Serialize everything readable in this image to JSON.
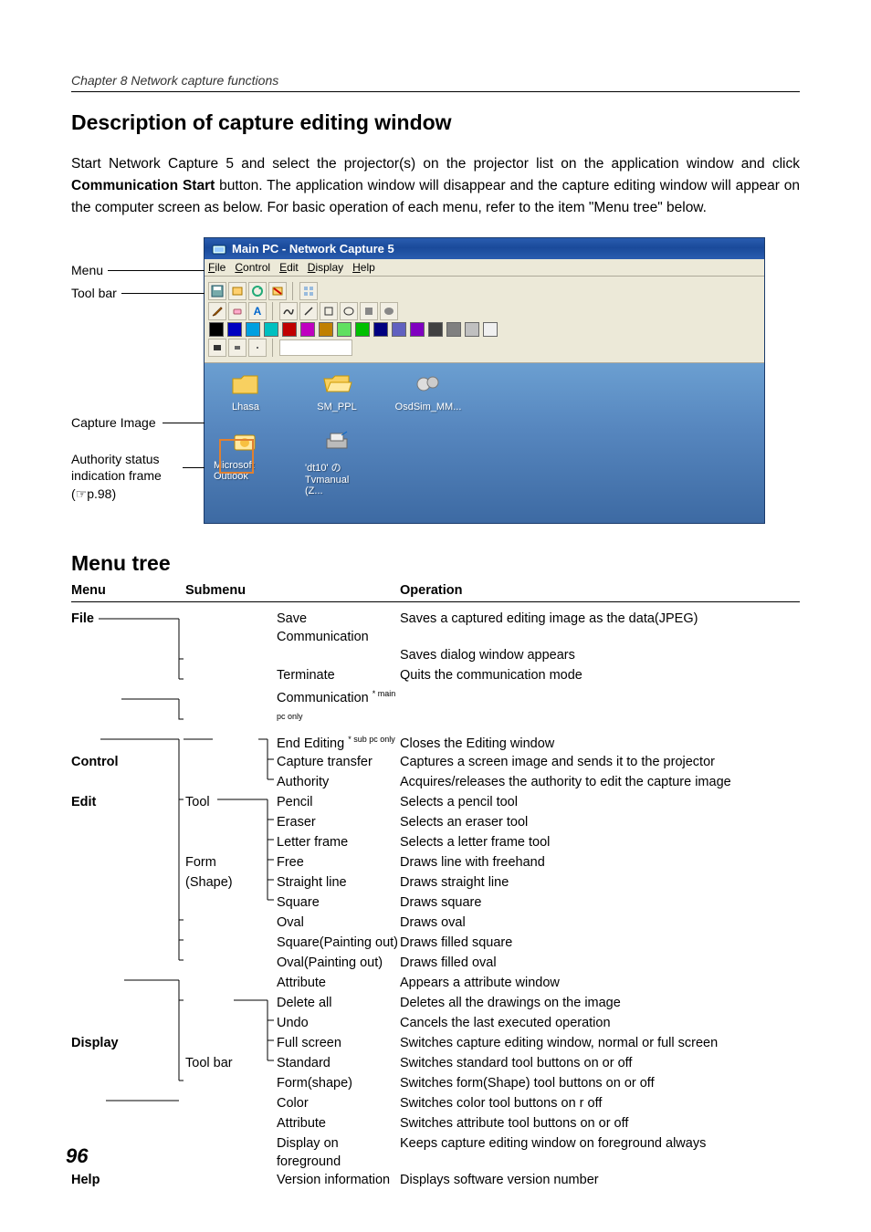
{
  "header": {
    "chapter": "Chapter 8 Network capture functions"
  },
  "section1": {
    "title": "Description of capture editing window",
    "intro_pre": "Start Network Capture 5 and select the projector(s) on the projector list on the application window and click ",
    "intro_bold": "Communication Start",
    "intro_post": " button. The application window will disappear and the capture editing window will appear on the computer screen as below. For basic operation of each menu, refer to the item \"Menu tree\" below."
  },
  "figure": {
    "labels": {
      "menu": "Menu",
      "toolbar": "Tool bar",
      "capture": "Capture Image",
      "auth1": "Authority status",
      "auth2": "indication frame",
      "auth3": "(☞p.98)"
    },
    "window": {
      "title": "Main PC - Network Capture 5",
      "menus": {
        "file": "File",
        "control": "Control",
        "edit": "Edit",
        "display": "Display",
        "help": "Help"
      },
      "swatches": [
        "#000000",
        "#0000c0",
        "#00a0e0",
        "#00c0c0",
        "#c00000",
        "#c000c0",
        "#c08000",
        "#60e060",
        "#00c000",
        "#000080",
        "#6060c0",
        "#8000c0",
        "#404040",
        "#808080",
        "#c0c0c0",
        "#f0f0f0"
      ],
      "desktop": {
        "row1": [
          {
            "name": "Lhasa",
            "icon": "folder"
          },
          {
            "name": "SM_PPL",
            "icon": "folder-open"
          },
          {
            "name": "OsdSim_MM...",
            "icon": "gears"
          }
        ],
        "row2": [
          {
            "name": "Microsoft Outlook",
            "icon": "outlook"
          },
          {
            "name": "'dt10' の Tvmanual (Z...",
            "icon": "printer"
          }
        ]
      }
    }
  },
  "section2": {
    "title": "Menu tree",
    "headers": {
      "menu": "Menu",
      "submenu": "Submenu",
      "operation": "Operation"
    },
    "rows": [
      {
        "c1": "File",
        "c2a": "",
        "c2b": "Save Communication",
        "c3": "Saves a captured editing image as the data(JPEG)"
      },
      {
        "c1": "",
        "c2a": "",
        "c2b": "",
        "c3": "Saves dialog window appears"
      },
      {
        "c1": "",
        "c2a": "",
        "c2b_pre": "Terminate Communication ",
        "c2b_sup": "* main pc only",
        "c3": "Quits the communication mode"
      },
      {
        "c1": "",
        "c2a": "",
        "c2b_pre": "End Editing ",
        "c2b_sup": "* sub pc only",
        "c3": "Closes the Editing window"
      },
      {
        "c1": "Control",
        "c2a": "",
        "c2b": "Capture transfer",
        "c3": "Captures a screen image and sends it to the projector"
      },
      {
        "c1": "",
        "c2a": "",
        "c2b": "Authority",
        "c3": "Acquires/releases the authority to edit the capture image"
      },
      {
        "c1": "Edit",
        "c2a": "Tool",
        "c2b": "Pencil",
        "c3": "Selects a pencil tool"
      },
      {
        "c1": "",
        "c2a": "",
        "c2b": "Eraser",
        "c3": "Selects an eraser tool"
      },
      {
        "c1": "",
        "c2a": "",
        "c2b": "Letter frame",
        "c3": "Selects a letter frame tool"
      },
      {
        "c1": "",
        "c2a": "Form",
        "c2b": "Free",
        "c3": "Draws line with freehand"
      },
      {
        "c1": "",
        "c2a": "(Shape)",
        "c2b": "Straight line",
        "c3": "Draws straight line"
      },
      {
        "c1": "",
        "c2a": "",
        "c2b": "Square",
        "c3": "Draws square"
      },
      {
        "c1": "",
        "c2a": "",
        "c2b": "Oval",
        "c3": "Draws oval"
      },
      {
        "c1": "",
        "c2a": "",
        "c2b": "Square(Painting out)",
        "c3": "Draws filled square"
      },
      {
        "c1": "",
        "c2a": "",
        "c2b": "Oval(Painting out)",
        "c3": "Draws filled oval"
      },
      {
        "c1": "",
        "c2a": "",
        "c2b": "Attribute",
        "c3": "Appears a attribute window"
      },
      {
        "c1": "",
        "c2a": "",
        "c2b": "Delete all",
        "c3": "Deletes all the drawings on the image"
      },
      {
        "c1": "",
        "c2a": "",
        "c2b": "Undo",
        "c3": "Cancels the last executed operation"
      },
      {
        "c1": "Display",
        "c2a": "",
        "c2b": "Full screen",
        "c3": "Switches capture editing window, normal or full screen"
      },
      {
        "c1": "",
        "c2a": "Tool bar",
        "c2b": "Standard",
        "c3": "Switches standard tool buttons on or off"
      },
      {
        "c1": "",
        "c2a": "",
        "c2b": "Form(shape)",
        "c3": "Switches form(Shape) tool buttons on or off"
      },
      {
        "c1": "",
        "c2a": "",
        "c2b": "Color",
        "c3": "Switches color tool buttons on r off"
      },
      {
        "c1": "",
        "c2a": "",
        "c2b": "Attribute",
        "c3": "Switches attribute tool buttons on or off"
      },
      {
        "c1": "",
        "c2a": "",
        "c2b": "Display on foreground",
        "c3": "Keeps capture editing window on foreground always"
      },
      {
        "c1": "Help",
        "c2a": "",
        "c2b": "Version information",
        "c3": "Displays software version number"
      }
    ]
  },
  "page_number": "96"
}
